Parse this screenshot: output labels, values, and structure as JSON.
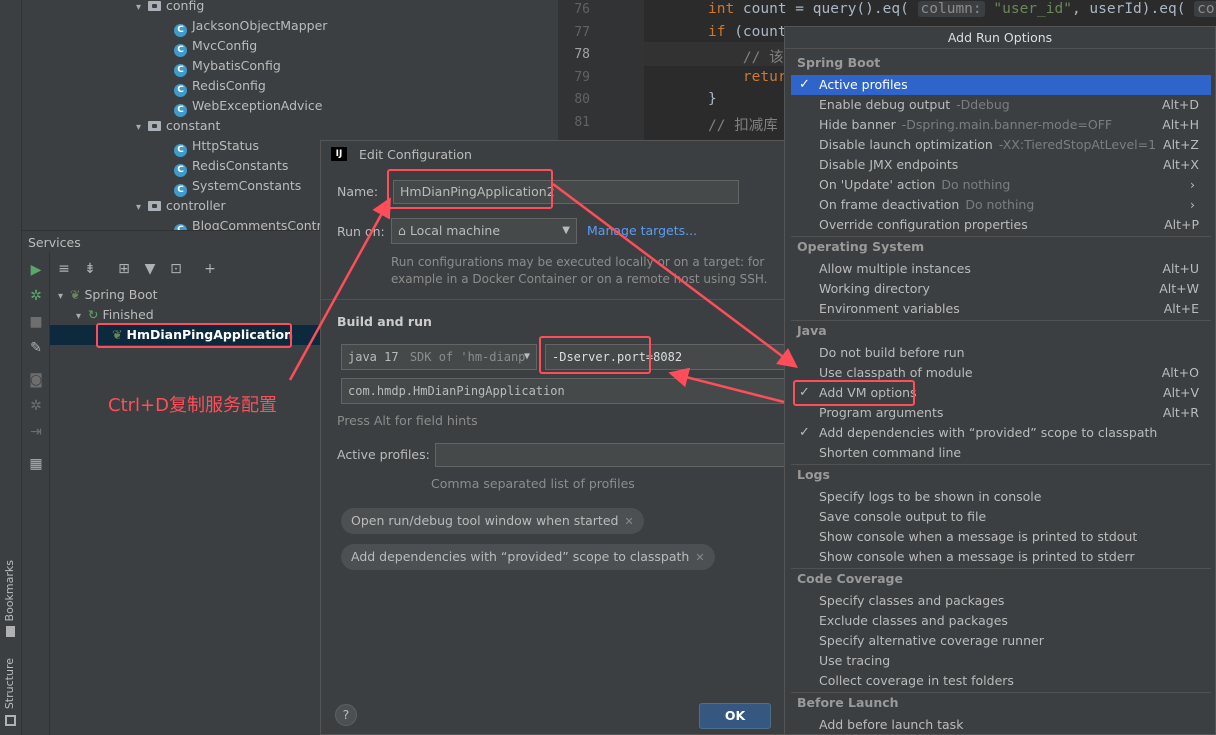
{
  "project_tree": {
    "items": [
      {
        "kind": "folder",
        "label": "config",
        "indent": 2
      },
      {
        "kind": "class",
        "label": "JacksonObjectMapper"
      },
      {
        "kind": "class",
        "label": "MvcConfig"
      },
      {
        "kind": "class",
        "label": "MybatisConfig"
      },
      {
        "kind": "class",
        "label": "RedisConfig"
      },
      {
        "kind": "class",
        "label": "WebExceptionAdvice"
      },
      {
        "kind": "folder",
        "label": "constant"
      },
      {
        "kind": "class",
        "label": "HttpStatus"
      },
      {
        "kind": "class",
        "label": "RedisConstants"
      },
      {
        "kind": "class",
        "label": "SystemConstants"
      },
      {
        "kind": "folder",
        "label": "controller"
      },
      {
        "kind": "class",
        "label": "BlogCommentsController"
      }
    ]
  },
  "services": {
    "title": "Services",
    "tree": {
      "root": "Spring Boot",
      "group": "Finished",
      "app": "HmDianPingApplication"
    }
  },
  "annotation": {
    "text": "Ctrl+D复制服务配置",
    "color": "#ff4d5a"
  },
  "editor": {
    "lines": [
      {
        "num": "76",
        "code_html": "<span class=\"kw\">int</span> count = query().eq( <span class=\"hint\">column:</span> <span class=\"str\">\"user_id\"</span>, userId).eq( <span class=\"hint\">col</span>"
      },
      {
        "num": "77",
        "code_html": "<span class=\"kw\">if</span> (count"
      },
      {
        "num": "78",
        "code_html": "    <span class=\"cmt\">// 该</span>"
      },
      {
        "num": "79",
        "code_html": "    <span class=\"kw\">retur</span>"
      },
      {
        "num": "80",
        "code_html": "}"
      },
      {
        "num": "81",
        "code_html": "<span class=\"cmt\">// 扣减库</span>"
      }
    ]
  },
  "dialog": {
    "title": "Edit Configuration",
    "name_label": "Name:",
    "name_value": "HmDianPingApplication2",
    "run_on_label": "Run on:",
    "run_on_value": "Local machine",
    "manage_targets": "Manage targets...",
    "run_on_help": "Run configurations may be executed locally or on a target: for example in a Docker Container or on a remote host using SSH.",
    "build_and_run": "Build and run",
    "jdk_value": "java 17",
    "jdk_detail": "SDK of 'hm-dianp",
    "vm_options": "-Dserver.port=8082",
    "main_class": "com.hmdp.HmDianPingApplication",
    "field_hint": "Press Alt for field hints",
    "active_profiles_label": "Active profiles:",
    "active_profiles_value": "",
    "profiles_help": "Comma separated list of profiles",
    "chips": [
      "Open run/debug tool window when started",
      "Add dependencies with “provided” scope to classpath"
    ],
    "ok": "OK",
    "help": "?"
  },
  "popup": {
    "title": "Add Run Options",
    "sections": [
      {
        "title": "Spring Boot",
        "items": [
          {
            "label": "Active profiles",
            "checked": true,
            "selected": true
          },
          {
            "label": "Enable debug output",
            "sub": "-Ddebug",
            "key": "Alt+D"
          },
          {
            "label": "Hide banner",
            "sub": "-Dspring.main.banner-mode=OFF",
            "key": "Alt+H"
          },
          {
            "label": "Disable launch optimization",
            "sub": "-XX:TieredStopAtLevel=1",
            "key": "Alt+Z"
          },
          {
            "label": "Disable JMX endpoints",
            "key": "Alt+X"
          },
          {
            "label": "On 'Update' action",
            "sub": "Do nothing",
            "submenu": true
          },
          {
            "label": "On frame deactivation",
            "sub": "Do nothing",
            "submenu": true
          },
          {
            "label": "Override configuration properties",
            "key": "Alt+P"
          }
        ]
      },
      {
        "title": "Operating System",
        "items": [
          {
            "label": "Allow multiple instances",
            "key": "Alt+U"
          },
          {
            "label": "Working directory",
            "key": "Alt+W"
          },
          {
            "label": "Environment variables",
            "key": "Alt+E"
          }
        ]
      },
      {
        "title": "Java",
        "items": [
          {
            "label": "Do not build before run"
          },
          {
            "label": "Use classpath of module",
            "key": "Alt+O"
          },
          {
            "label": "Add VM options",
            "checked": true,
            "key": "Alt+V",
            "highlight": true
          },
          {
            "label": "Program arguments",
            "key": "Alt+R"
          },
          {
            "label": "Add dependencies with “provided” scope to classpath",
            "checked": true
          },
          {
            "label": "Shorten command line"
          }
        ]
      },
      {
        "title": "Logs",
        "items": [
          {
            "label": "Specify logs to be shown in console"
          },
          {
            "label": "Save console output to file"
          },
          {
            "label": "Show console when a message is printed to stdout"
          },
          {
            "label": "Show console when a message is printed to stderr"
          }
        ]
      },
      {
        "title": "Code Coverage",
        "items": [
          {
            "label": "Specify classes and packages"
          },
          {
            "label": "Exclude classes and packages"
          },
          {
            "label": "Specify alternative coverage runner"
          },
          {
            "label": "Use tracing"
          },
          {
            "label": "Collect coverage in test folders"
          }
        ]
      },
      {
        "title": "Before Launch",
        "items": [
          {
            "label": "Add before launch task"
          }
        ]
      }
    ]
  },
  "side_tabs": {
    "bookmarks": "Bookmarks",
    "structure": "Structure"
  }
}
